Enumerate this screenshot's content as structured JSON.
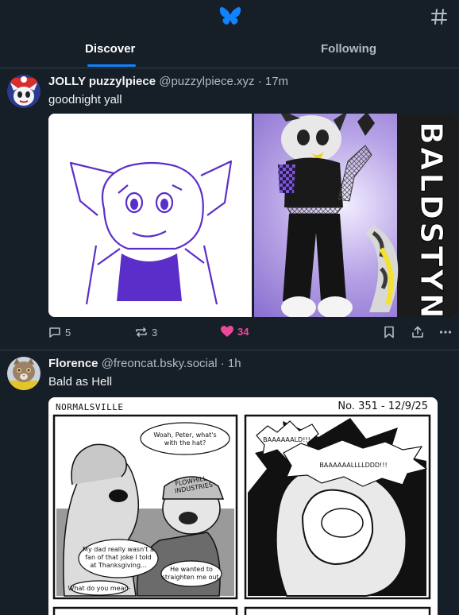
{
  "header": {
    "logo_icon": "butterfly-icon",
    "feeds_icon": "hash-icon",
    "tabs": [
      {
        "label": "Discover",
        "active": true
      },
      {
        "label": "Following",
        "active": false
      }
    ],
    "accent_color": "#1083fe"
  },
  "posts": [
    {
      "display_name": "JOLLY puzzylpiece",
      "handle": "@puzzylpiece.xyz",
      "time": "· 17m",
      "text": "goodnight yall",
      "replies": "5",
      "reposts": "3",
      "likes": "34",
      "liked": true,
      "image_side_text": "BALDSTYN"
    },
    {
      "display_name": "Florence",
      "handle": "@freoncat.bsky.social",
      "time": "· 1h",
      "text": "Bald as Hell",
      "comic": {
        "title": "NORMALSVILLE",
        "number": "No. 351 - 12/9/25",
        "bubble1": [
          "Woah, Peter, what's",
          "with the hat?"
        ],
        "cap_text": [
          "FLOWHILL",
          "INDUSTRIES"
        ],
        "bubble2": [
          "My dad really wasn't a",
          "fan of that joke I told",
          "at Thanksgiving..."
        ],
        "bubble3": [
          "He wanted to",
          "straighten me out."
        ],
        "bubble4": "What do you mean-",
        "shout1": "BAAAAAALD!!!",
        "shout2": "BAAAAAALLLLDDD!!!"
      }
    }
  ],
  "colors": {
    "background": "#161e27",
    "border": "#2e4052",
    "muted_text": "#aebbc9",
    "like": "#ec4899"
  }
}
